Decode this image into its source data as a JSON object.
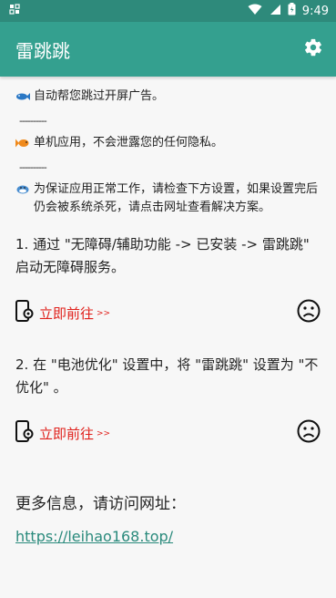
{
  "status_bar": {
    "time": "9:49"
  },
  "app_bar": {
    "title": "雷跳跳",
    "settings_icon": "gear-icon"
  },
  "intro": {
    "line1": "自动帮您跳过开屏广告。",
    "sep1": "----------",
    "line2": "单机应用，不会泄露您的任何隐私。",
    "sep2": "----------",
    "line3": "为保证应用正常工作，请检查下方设置，如果设置完后仍会被系统杀死，请点击网址查看解决方案。"
  },
  "step1": {
    "text": "1. 通过 \"无障碍/辅助功能 -> 已安装 -> 雷跳跳\" 启动无障碍服务。",
    "link_label": "立即前往",
    "link_arrow": ">>",
    "status": "sad"
  },
  "step2": {
    "text": "2. 在 \"电池优化\" 设置中，将 \"雷跳跳\" 设置为 \"不优化\" 。",
    "link_label": "立即前往",
    "link_arrow": ">>",
    "status": "sad"
  },
  "more_info": {
    "label": "更多信息，请访问网址：",
    "url": "https://leihao168.top/"
  },
  "colors": {
    "status_bar": "#2e8a7b",
    "app_bar": "#34a08f",
    "link_red": "#e0201b",
    "url": "#2a8a7c"
  }
}
